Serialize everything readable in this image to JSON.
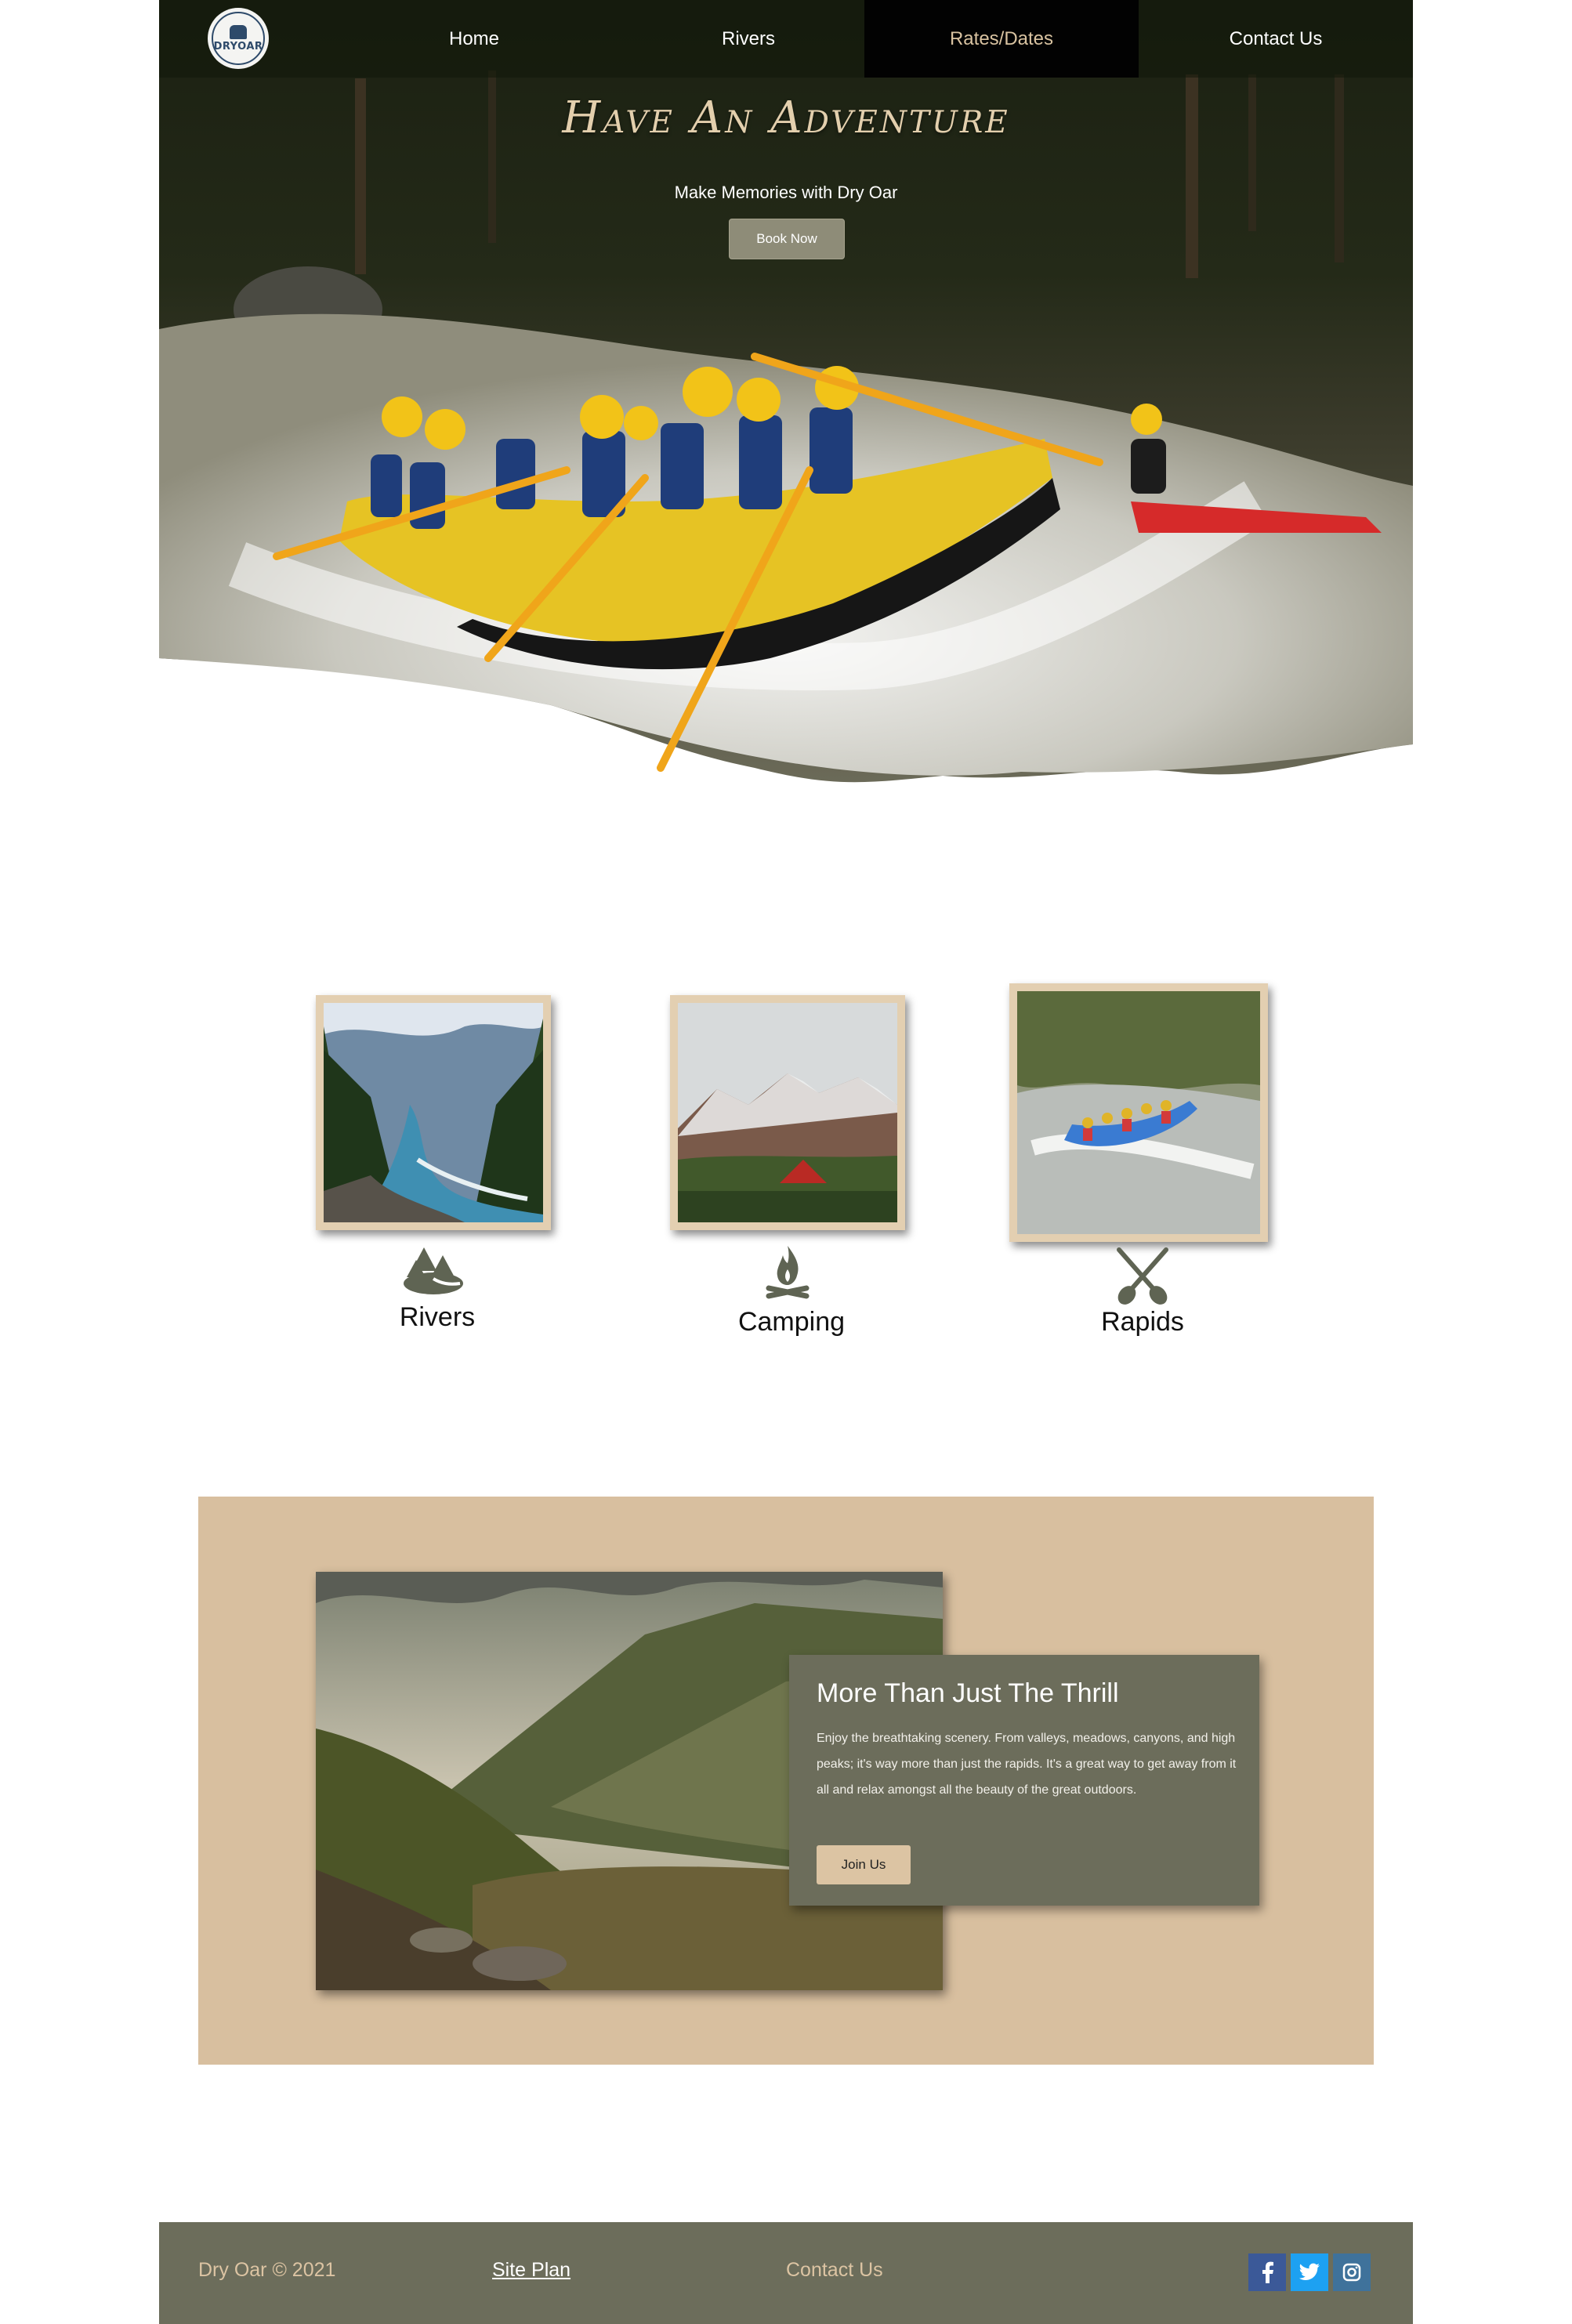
{
  "nav": {
    "logo_text": "DRYOAR",
    "items": [
      {
        "label": "Home"
      },
      {
        "label": "Rivers"
      },
      {
        "label": "Rates/Dates",
        "active": true
      },
      {
        "label": "Contact Us"
      }
    ]
  },
  "hero": {
    "title": "Have An Adventure",
    "subtitle": "Make Memories with Dry Oar",
    "button": "Book Now"
  },
  "cards": [
    {
      "label": "Rivers",
      "icon": "trees-icon"
    },
    {
      "label": "Camping",
      "icon": "campfire-icon"
    },
    {
      "label": "Rapids",
      "icon": "crossed-paddles-icon"
    }
  ],
  "feature": {
    "title": "More Than Just The Thrill",
    "body": "Enjoy the breathtaking scenery. From valleys, meadows, canyons, and high peaks; it's way more than just the rapids. It's a great way to get away from it all and relax amongst all the beauty of the great outdoors.",
    "button": "Join Us"
  },
  "footer": {
    "copyright": "Dry Oar © 2021",
    "site_plan": "Site Plan",
    "contact": "Contact Us",
    "social": [
      {
        "name": "facebook-icon",
        "glyph": "f",
        "color": "#3b5998"
      },
      {
        "name": "twitter-icon",
        "glyph": "t",
        "color": "#1da1f2"
      },
      {
        "name": "instagram-icon",
        "glyph": "◎",
        "color": "#3f729b"
      }
    ]
  },
  "colors": {
    "accent_tan": "#d8bf9f",
    "olive": "#6c6d5b",
    "nav_active": "#020202"
  }
}
